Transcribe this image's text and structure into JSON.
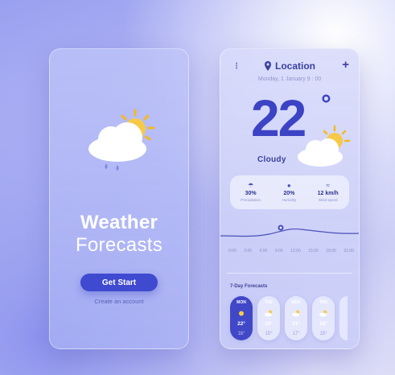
{
  "welcome": {
    "title_line1": "Weather",
    "title_line2": "Forecasts",
    "start_button": "Get Start",
    "account_link": "Create an account",
    "icon": "cloud-sun-rain-icon"
  },
  "forecast": {
    "menu_icon": "⋮",
    "location_label": "Location",
    "add_icon": "+",
    "date": "Monday, 1 January 9 : 00",
    "temperature": "22",
    "degree_symbol": "°",
    "condition": "Cloudy",
    "stats": [
      {
        "icon": "☂",
        "value": "30%",
        "label": "Precipitation"
      },
      {
        "icon": "●",
        "value": "20%",
        "label": "Humidity"
      },
      {
        "icon": "≈",
        "value": "12 km/h",
        "label": "Wind speed"
      }
    ],
    "hours": [
      "0:00",
      "3:00",
      "6:00",
      "9:00",
      "12:00",
      "15:00",
      "18:00",
      "21:00"
    ],
    "week_title": "7-Day Forecasts",
    "days": [
      {
        "name": "MON",
        "high": "22°",
        "low": "16°"
      },
      {
        "name": "TUE",
        "high": "20°",
        "low": "15°"
      },
      {
        "name": "WED",
        "high": "21°",
        "low": "17°"
      },
      {
        "name": "THU",
        "high": "18°",
        "low": "15°"
      }
    ]
  },
  "colors": {
    "accent": "#4048c8",
    "sun": "#f7c948",
    "text_dark": "#3a3f9e"
  }
}
